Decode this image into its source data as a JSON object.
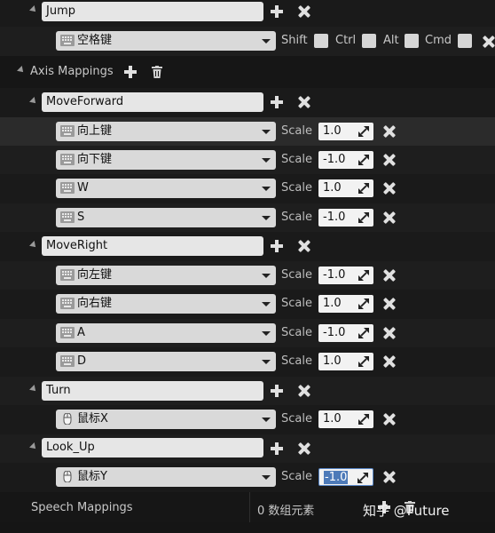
{
  "action_jump": {
    "name": "Jump",
    "key": "空格键",
    "modifiers": [
      "Shift",
      "Ctrl",
      "Alt",
      "Cmd"
    ]
  },
  "axis_mappings": {
    "title": "Axis Mappings"
  },
  "scale_label": "Scale",
  "groups": [
    {
      "name": "MoveForward",
      "bindings": [
        {
          "key": "向上键",
          "scale": "1.0"
        },
        {
          "key": "向下键",
          "scale": "-1.0"
        },
        {
          "key": "W",
          "scale": "1.0"
        },
        {
          "key": "S",
          "scale": "-1.0"
        }
      ]
    },
    {
      "name": "MoveRight",
      "bindings": [
        {
          "key": "向左键",
          "scale": "-1.0"
        },
        {
          "key": "向右键",
          "scale": "1.0"
        },
        {
          "key": "A",
          "scale": "-1.0"
        },
        {
          "key": "D",
          "scale": "1.0"
        }
      ]
    },
    {
      "name": "Turn",
      "bindings": [
        {
          "key": "鼠标X",
          "scale": "1.0"
        }
      ]
    },
    {
      "name": "Look_Up",
      "bindings": [
        {
          "key": "鼠标Y",
          "scale": "-1.0"
        }
      ]
    }
  ],
  "speech_mappings": {
    "title": "Speech Mappings",
    "count_text": "0 数组元素"
  },
  "watermark": "知乎 @Future",
  "colors": {
    "selection": "#4d7ab8",
    "field_bg": "#e6e6e6",
    "panel_bg": "#151515"
  }
}
